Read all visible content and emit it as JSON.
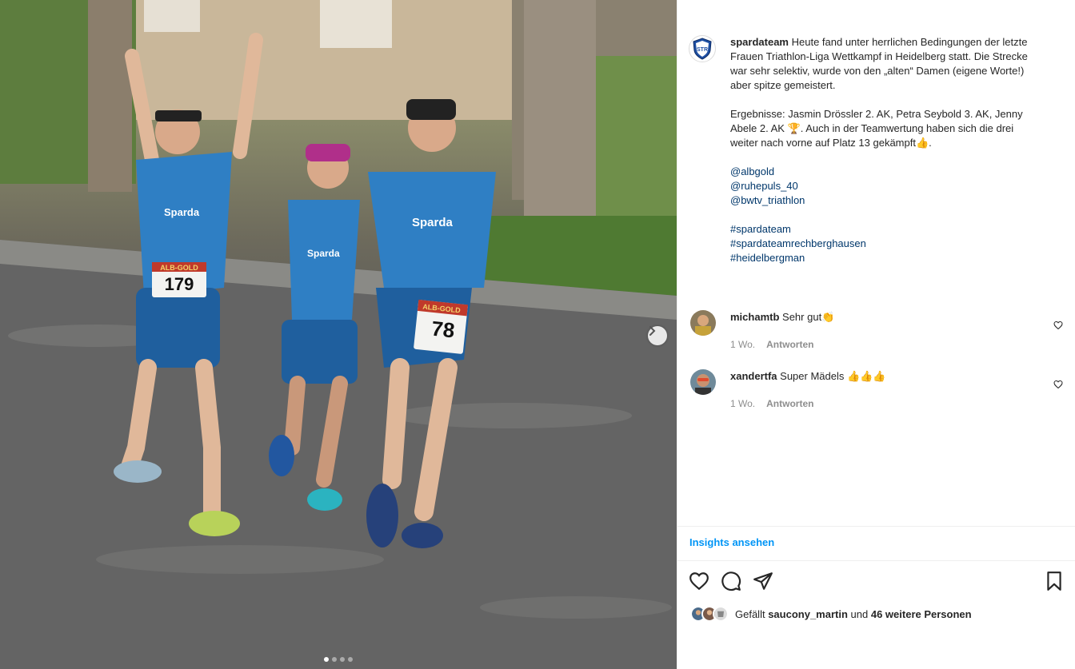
{
  "post": {
    "owner_username": "spardateam",
    "owner_logo_text": "STR",
    "caption_lines": [
      "Heute fand unter herrlichen Bedingungen der letzte",
      "Frauen Triathlon-Liga Wettkampf in Heidelberg statt. Die Strecke",
      "war sehr selektiv, wurde von den „alten“ Damen (eigene Worte!)",
      "aber spitze gemeistert."
    ],
    "results_lines": [
      "Ergebnisse: Jasmin Drössler 2. AK, Petra Seybold 3. AK, Jenny",
      "Abele 2. AK 🏆. Auch in der Teamwertung haben sich die drei",
      "weiter nach vorne auf Platz 13 gekämpft👍."
    ],
    "mentions": [
      "@albgold",
      "@ruhepuls_40",
      "@bwtv_triathlon"
    ],
    "hashtags": [
      "#spardateam",
      "#spardateamrechberghausen",
      "#heidelbergman"
    ]
  },
  "photo": {
    "bib_left": "179",
    "bib_right": "78",
    "bib_sponsor": "ALB-GOLD",
    "jersey_text": "Sparda",
    "carousel_count": 4,
    "carousel_active": 0
  },
  "comments": [
    {
      "username": "michamtb",
      "text": "Sehr gut👏",
      "age": "1 Wo.",
      "reply_label": "Antworten"
    },
    {
      "username": "xandertfa",
      "text": "Super Mädels 👍👍👍",
      "age": "1 Wo.",
      "reply_label": "Antworten"
    }
  ],
  "insights_label": "Insights ansehen",
  "likes": {
    "prefix": "Gefällt",
    "user": "saucony_martin",
    "middle": "und",
    "others": "46 weitere Personen"
  },
  "icons": {
    "like": "heart-icon",
    "comment": "comment-bubble-icon",
    "share": "paper-plane-icon",
    "save": "bookmark-icon",
    "next": "chevron-right-icon"
  },
  "colors": {
    "link": "#00376b",
    "accent": "#0095f6",
    "meta": "#8e8e8e",
    "text": "#262626"
  }
}
